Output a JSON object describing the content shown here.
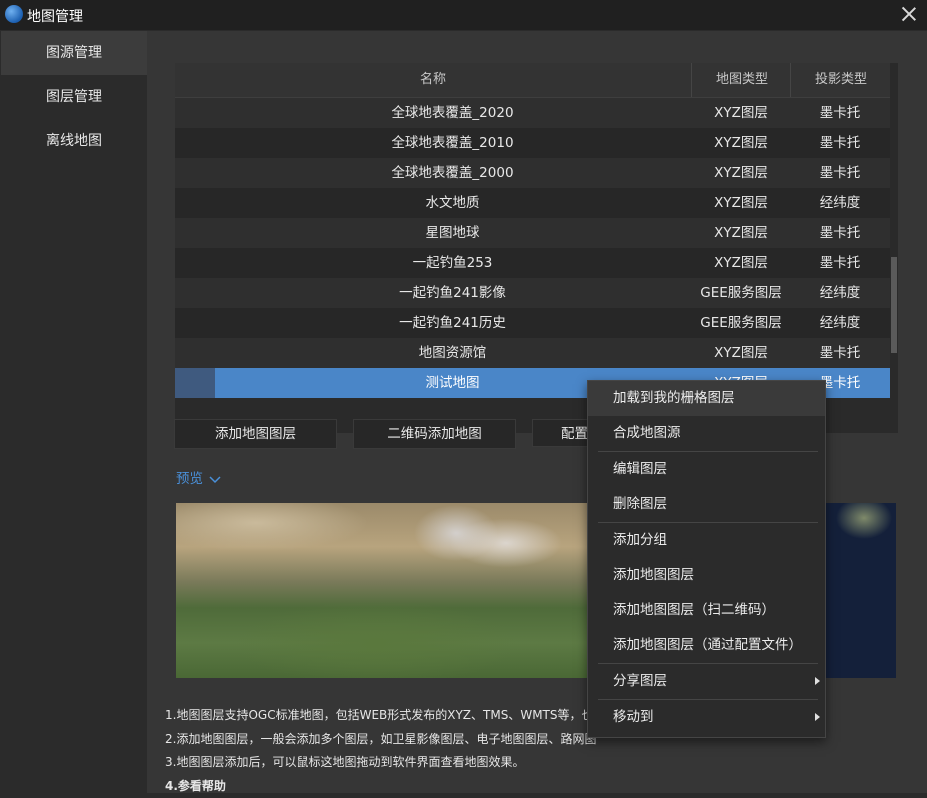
{
  "window": {
    "title": "地图管理"
  },
  "sidebar": {
    "items": [
      {
        "label": "图源管理"
      },
      {
        "label": "图层管理"
      },
      {
        "label": "离线地图"
      }
    ]
  },
  "table": {
    "headers": [
      "名称",
      "地图类型",
      "投影类型"
    ],
    "rows": [
      [
        "全球地表覆盖_2020",
        "XYZ图层",
        "墨卡托"
      ],
      [
        "全球地表覆盖_2010",
        "XYZ图层",
        "墨卡托"
      ],
      [
        "全球地表覆盖_2000",
        "XYZ图层",
        "墨卡托"
      ],
      [
        "水文地质",
        "XYZ图层",
        "经纬度"
      ],
      [
        "星图地球",
        "XYZ图层",
        "墨卡托"
      ],
      [
        "一起钓鱼253",
        "XYZ图层",
        "墨卡托"
      ],
      [
        "一起钓鱼241影像",
        "GEE服务图层",
        "经纬度"
      ],
      [
        "一起钓鱼241历史",
        "GEE服务图层",
        "经纬度"
      ],
      [
        "地图资源馆",
        "XYZ图层",
        "墨卡托"
      ],
      [
        "测试地图",
        "XYZ图层",
        "墨卡托"
      ]
    ],
    "selected_index": 9
  },
  "buttons": {
    "add_layer": "添加地图图层",
    "qr_add": "二维码添加地图",
    "config": "配置"
  },
  "preview": {
    "label": "预览"
  },
  "context_menu": {
    "items": [
      {
        "label": "加载到我的栅格图层"
      },
      {
        "label": "合成地图源"
      },
      {
        "label": "编辑图层"
      },
      {
        "label": "删除图层"
      },
      {
        "label": "添加分组"
      },
      {
        "label": "添加地图图层"
      },
      {
        "label": "添加地图图层（扫二维码）"
      },
      {
        "label": "添加地图图层（通过配置文件）"
      },
      {
        "label": "分享图层"
      },
      {
        "label": "移动到"
      }
    ]
  },
  "help": {
    "line1": "1.地图图层支持OGC标准地图，包括WEB形式发布的XYZ、TMS、WMTS等，也",
    "line2": "2.添加地图图层，一般会添加多个图层，如卫星影像图层、电子地图图层、路网图",
    "line3": "3.地图图层添加后，可以鼠标这地图拖动到软件界面查看地图效果。",
    "line4": "4.参看帮助"
  },
  "colors": {
    "accent": "#4a90d9",
    "selection": "#4a86c8"
  },
  "icons": {
    "app": "globe-icon",
    "close": "close-icon",
    "preview_toggle": "chevron-down-icon",
    "submenu": "chevron-right-icon"
  }
}
